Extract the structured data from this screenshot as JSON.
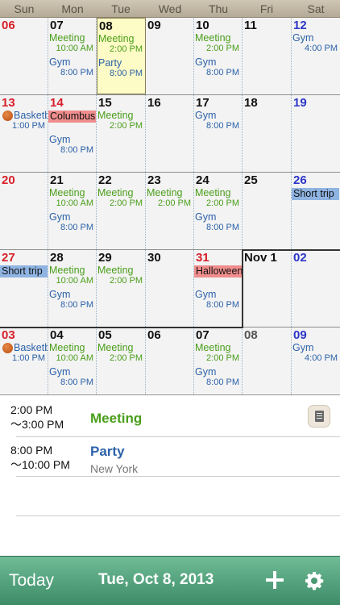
{
  "weekdays": [
    "Sun",
    "Mon",
    "Tue",
    "Wed",
    "Thu",
    "Fri",
    "Sat"
  ],
  "weeks": [
    {
      "days": [
        {
          "num": "06",
          "style": "sun",
          "events": []
        },
        {
          "num": "07",
          "style": "",
          "events": [
            {
              "type": "text",
              "title": "Meeting",
              "color": "green",
              "time": "10:00 AM"
            },
            {
              "type": "text",
              "title": "Gym",
              "color": "blue",
              "time": "8:00 PM"
            }
          ]
        },
        {
          "num": "08",
          "style": "",
          "today": true,
          "events": [
            {
              "type": "text",
              "title": "Meeting",
              "color": "green",
              "time": "2:00 PM"
            },
            {
              "type": "text",
              "title": "Party",
              "color": "blue",
              "time": "8:00 PM"
            }
          ]
        },
        {
          "num": "09",
          "style": "",
          "events": []
        },
        {
          "num": "10",
          "style": "",
          "events": [
            {
              "type": "text",
              "title": "Meeting",
              "color": "green",
              "time": "2:00 PM"
            },
            {
              "type": "text",
              "title": "Gym",
              "color": "blue",
              "time": "8:00 PM"
            }
          ]
        },
        {
          "num": "11",
          "style": "",
          "events": []
        },
        {
          "num": "12",
          "style": "sat",
          "events": [
            {
              "type": "text",
              "title": "Gym",
              "color": "blue",
              "time": "4:00 PM"
            }
          ]
        }
      ]
    },
    {
      "days": [
        {
          "num": "13",
          "style": "sun",
          "events": [
            {
              "type": "ball",
              "title": "Basketball",
              "color": "blue",
              "time": "1:00 PM"
            }
          ]
        },
        {
          "num": "14",
          "style": "sun",
          "events": [
            {
              "type": "bar",
              "title": "Columbus",
              "color": "red"
            },
            {
              "type": "text",
              "title": "Gym",
              "color": "blue",
              "time": "8:00 PM"
            }
          ]
        },
        {
          "num": "15",
          "style": "",
          "events": [
            {
              "type": "text",
              "title": "Meeting",
              "color": "green",
              "time": "2:00 PM"
            }
          ]
        },
        {
          "num": "16",
          "style": "",
          "events": []
        },
        {
          "num": "17",
          "style": "",
          "events": [
            {
              "type": "text",
              "title": "Gym",
              "color": "blue",
              "time": "8:00 PM"
            }
          ]
        },
        {
          "num": "18",
          "style": "",
          "events": []
        },
        {
          "num": "19",
          "style": "sat",
          "events": []
        }
      ]
    },
    {
      "days": [
        {
          "num": "20",
          "style": "sun",
          "events": []
        },
        {
          "num": "21",
          "style": "",
          "events": [
            {
              "type": "text",
              "title": "Meeting",
              "color": "green",
              "time": "10:00 AM"
            },
            {
              "type": "text",
              "title": "Gym",
              "color": "blue",
              "time": "8:00 PM"
            }
          ]
        },
        {
          "num": "22",
          "style": "",
          "events": [
            {
              "type": "text",
              "title": "Meeting",
              "color": "green",
              "time": "2:00 PM"
            }
          ]
        },
        {
          "num": "23",
          "style": "",
          "events": [
            {
              "type": "text",
              "title": "Meeting",
              "color": "green",
              "time": "2:00 PM"
            }
          ]
        },
        {
          "num": "24",
          "style": "",
          "events": [
            {
              "type": "text",
              "title": "Meeting",
              "color": "green",
              "time": "2:00 PM"
            },
            {
              "type": "text",
              "title": "Gym",
              "color": "blue",
              "time": "8:00 PM"
            }
          ]
        },
        {
          "num": "25",
          "style": "",
          "events": []
        },
        {
          "num": "26",
          "style": "sat",
          "events": [
            {
              "type": "bar",
              "title": "Short trip",
              "color": "blue"
            }
          ]
        }
      ]
    },
    {
      "days": [
        {
          "num": "27",
          "style": "sun",
          "events": [
            {
              "type": "bar",
              "title": "Short trip",
              "color": "blue"
            }
          ]
        },
        {
          "num": "28",
          "style": "",
          "events": [
            {
              "type": "text",
              "title": "Meeting",
              "color": "green",
              "time": "10:00 AM"
            },
            {
              "type": "text",
              "title": "Gym",
              "color": "blue",
              "time": "8:00 PM"
            }
          ]
        },
        {
          "num": "29",
          "style": "",
          "events": [
            {
              "type": "text",
              "title": "Meeting",
              "color": "green",
              "time": "2:00 PM"
            }
          ]
        },
        {
          "num": "30",
          "style": "",
          "events": []
        },
        {
          "num": "31",
          "style": "sun",
          "events": [
            {
              "type": "bar",
              "title": "Halloween",
              "color": "red"
            },
            {
              "type": "text",
              "title": "Gym",
              "color": "blue",
              "time": "8:00 PM"
            }
          ]
        },
        {
          "num": "Nov 1",
          "style": "",
          "novbox": true,
          "events": []
        },
        {
          "num": "02",
          "style": "sat",
          "events": []
        }
      ]
    },
    {
      "days": [
        {
          "num": "03",
          "style": "sun",
          "events": [
            {
              "type": "ball",
              "title": "Basketball",
              "color": "blue",
              "time": "1:00 PM"
            }
          ]
        },
        {
          "num": "04",
          "style": "",
          "events": [
            {
              "type": "text",
              "title": "Meeting",
              "color": "green",
              "time": "10:00 AM"
            },
            {
              "type": "text",
              "title": "Gym",
              "color": "blue",
              "time": "8:00 PM"
            }
          ]
        },
        {
          "num": "05",
          "style": "",
          "events": [
            {
              "type": "text",
              "title": "Meeting",
              "color": "green",
              "time": "2:00 PM"
            }
          ]
        },
        {
          "num": "06",
          "style": "",
          "events": []
        },
        {
          "num": "07",
          "style": "",
          "events": [
            {
              "type": "text",
              "title": "Meeting",
              "color": "green",
              "time": "2:00 PM"
            },
            {
              "type": "text",
              "title": "Gym",
              "color": "blue",
              "time": "8:00 PM"
            }
          ]
        },
        {
          "num": "08",
          "style": "gray",
          "events": []
        },
        {
          "num": "09",
          "style": "sat",
          "events": [
            {
              "type": "text",
              "title": "Gym",
              "color": "blue",
              "time": "4:00 PM"
            }
          ]
        }
      ]
    }
  ],
  "detail": {
    "events": [
      {
        "start": "2:00 PM",
        "end": "〜3:00 PM",
        "title": "Meeting",
        "color": "green",
        "location": "",
        "note_icon": "note-icon"
      },
      {
        "start": "8:00 PM",
        "end": "〜10:00 PM",
        "title": "Party",
        "color": "blue",
        "location": "New York",
        "note_icon": ""
      }
    ]
  },
  "toolbar": {
    "today_label": "Today",
    "date_label": "Tue, Oct 8, 2013",
    "add_icon": "plus-icon",
    "settings_icon": "gear-icon"
  },
  "colors": {
    "toolbar": "#4fa37c",
    "today_cell": "#fdfcc6",
    "sunday": "#d8202a",
    "saturday": "#2d36c8",
    "event_green": "#4a9e1a",
    "event_blue": "#2c62a8",
    "bar_red": "#f08d8d",
    "bar_blue": "#8fb4e2"
  }
}
